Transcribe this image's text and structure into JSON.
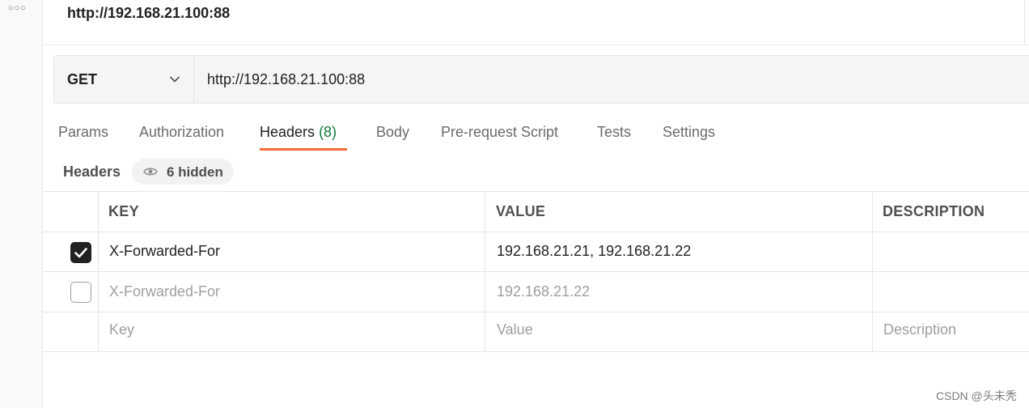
{
  "colors": {
    "accent": "#ff6c37",
    "count": "#0f7b3e",
    "checkbox_checked": "#212121"
  },
  "rail": {
    "icon": "ellipsis-icon"
  },
  "request": {
    "title": "http://192.168.21.100:88",
    "method": "GET",
    "url": "http://192.168.21.100:88"
  },
  "tabs": [
    {
      "label": "Params"
    },
    {
      "label": "Authorization"
    },
    {
      "label": "Headers",
      "count": "(8)",
      "active": true
    },
    {
      "label": "Body"
    },
    {
      "label": "Pre-request Script"
    },
    {
      "label": "Tests"
    },
    {
      "label": "Settings"
    }
  ],
  "headers_section": {
    "label": "Headers",
    "hidden_label": "6 hidden"
  },
  "table": {
    "columns": [
      "KEY",
      "VALUE",
      "DESCRIPTION"
    ],
    "rows": [
      {
        "checked": true,
        "key": "X-Forwarded-For",
        "value": "192.168.21.21, 192.168.21.22",
        "description": ""
      },
      {
        "checked": false,
        "key": "X-Forwarded-For",
        "value": "192.168.21.22",
        "description": ""
      }
    ],
    "placeholder": {
      "key": "Key",
      "value": "Value",
      "description": "Description"
    }
  },
  "watermark": "CSDN @头未秃"
}
